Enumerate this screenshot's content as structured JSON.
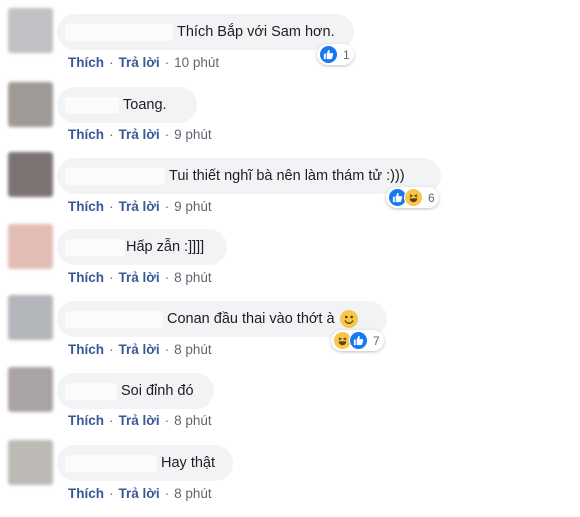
{
  "comments": [
    {
      "avatar_color": "#bfc1c4",
      "text": "Thích Bắp với Sam hơn.",
      "action_like": "Thích",
      "action_reply": "Trả lời",
      "time": "10 phút",
      "reactions": [
        "like"
      ],
      "reaction_count": "1"
    },
    {
      "avatar_color": "#9f9a96",
      "text": "Toang.",
      "action_like": "Thích",
      "action_reply": "Trả lời",
      "time": "9 phút",
      "reactions": [],
      "reaction_count": ""
    },
    {
      "avatar_color": "#7c7473",
      "text": "Tui thiết nghĩ bà nên làm thám tử :)))",
      "action_like": "Thích",
      "action_reply": "Trả lời",
      "time": "9 phút",
      "reactions": [
        "like",
        "haha"
      ],
      "reaction_count": "6"
    },
    {
      "avatar_color": "#e2bdb5",
      "text": "Hấp zẫn :]]]]",
      "action_like": "Thích",
      "action_reply": "Trả lời",
      "time": "8 phút",
      "reactions": [],
      "reaction_count": ""
    },
    {
      "avatar_color": "#b3b6ba",
      "text": "Conan đầu thai vào thớt à",
      "action_like": "Thích",
      "action_reply": "Trả lời",
      "time": "8 phút",
      "reactions": [
        "haha",
        "like"
      ],
      "reaction_count": "7",
      "inline_emoji": "smile-emoji"
    },
    {
      "avatar_color": "#aaa3a3",
      "text": "Soi đỉnh đó",
      "action_like": "Thích",
      "action_reply": "Trả lời",
      "time": "8 phút",
      "reactions": [],
      "reaction_count": ""
    },
    {
      "avatar_color": "#bdbab5",
      "text": "Hay thật",
      "action_like": "Thích",
      "action_reply": "Trả lời",
      "time": "8 phút",
      "reactions": [],
      "reaction_count": ""
    }
  ]
}
